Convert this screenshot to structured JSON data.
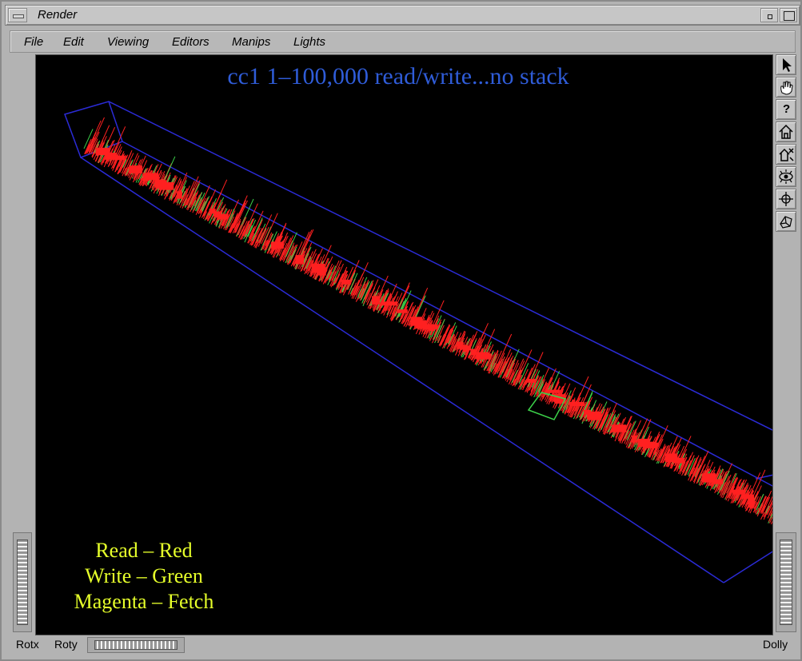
{
  "window": {
    "title": "Render"
  },
  "menu": [
    "File",
    "Edit",
    "Viewing",
    "Editors",
    "Manips",
    "Lights"
  ],
  "scene": {
    "title": "cc1  1–100,000 read/write...no stack",
    "legend": [
      "Read – Red",
      "Write – Green",
      "Magenta – Fetch"
    ],
    "colors": {
      "background": "#000000",
      "bounding_box": "#2b2bd6",
      "read": "#ff2020",
      "write": "#3cd24a",
      "fetch": "#e020e0",
      "title": "#2f5cd8",
      "legend": "#e6ff2a"
    }
  },
  "toolbar": {
    "tools": [
      "arrow-pointer-icon",
      "hand-icon",
      "help-icon",
      "home-icon",
      "set-home-icon",
      "view-all-icon",
      "seek-icon",
      "projection-icon"
    ],
    "help_glyph": "?"
  },
  "bottom": {
    "rotx_label": "Rotx",
    "roty_label": "Roty",
    "dolly_label": "Dolly"
  }
}
